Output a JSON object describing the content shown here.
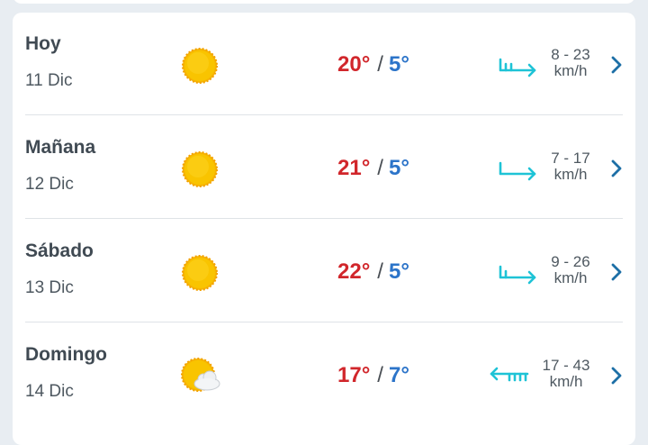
{
  "forecast": [
    {
      "day": "Hoy",
      "date": "11 Dic",
      "icon": "sun-icon",
      "max": "20°",
      "separator": "/",
      "min": "5°",
      "wind_icon": "wind-arrow-right-icon",
      "wind_speed": "8 - 23",
      "wind_unit": "km/h"
    },
    {
      "day": "Mañana",
      "date": "12 Dic",
      "icon": "sun-icon",
      "max": "21°",
      "separator": "/",
      "min": "5°",
      "wind_icon": "wind-arrow-right-icon",
      "wind_speed": "7 - 17",
      "wind_unit": "km/h"
    },
    {
      "day": "Sábado",
      "date": "13 Dic",
      "icon": "sun-icon",
      "max": "22°",
      "separator": "/",
      "min": "5°",
      "wind_icon": "wind-arrow-right-icon",
      "wind_speed": "9 - 26",
      "wind_unit": "km/h"
    },
    {
      "day": "Domingo",
      "date": "14 Dic",
      "icon": "sun-cloud-icon",
      "max": "17°",
      "separator": "/",
      "min": "7°",
      "wind_icon": "wind-arrow-left-icon",
      "wind_speed": "17 - 43",
      "wind_unit": "km/h"
    }
  ],
  "colors": {
    "max_temp": "#d1262b",
    "min_temp": "#2c74c9",
    "wind_arrow": "#1ec3d6",
    "chevron": "#1d6fa6",
    "sun": "#f5b400"
  }
}
